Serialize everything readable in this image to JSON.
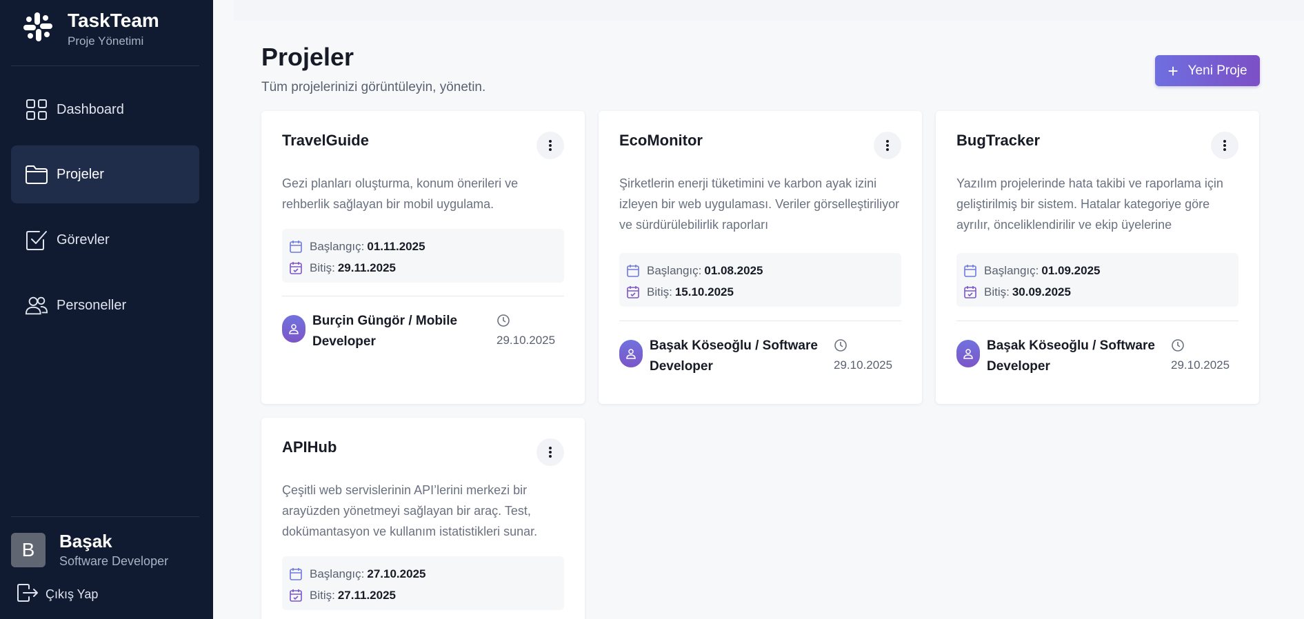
{
  "brand": {
    "name": "TaskTeam",
    "subtitle": "Proje Yönetimi"
  },
  "nav": [
    {
      "label": "Dashboard",
      "icon": "dashboard-grid-icon",
      "active": false
    },
    {
      "label": "Projeler",
      "icon": "folder-icon",
      "active": true
    },
    {
      "label": "Görevler",
      "icon": "checkbox-icon",
      "active": false
    },
    {
      "label": "Personeller",
      "icon": "users-icon",
      "active": false
    }
  ],
  "user": {
    "initial": "B",
    "name": "Başak",
    "role": "Software Developer",
    "logout_label": "Çıkış Yap"
  },
  "header": {
    "title": "Projeler",
    "subtitle": "Tüm projelerinizi görüntüleyin, yönetin.",
    "new_button_label": "Yeni Proje",
    "new_button_icon": "+"
  },
  "labels": {
    "start": "Başlangıç:",
    "end": "Bitiş:"
  },
  "colors": {
    "sidebar": "#101a30",
    "accent_start": "#6e6fe0",
    "accent_end": "#7d4fc6"
  },
  "projects": [
    {
      "title": "TravelGuide",
      "description": "Gezi planları oluşturma, konum önerileri ve rehberlik sağlayan bir mobil uygulama.",
      "start": "01.11.2025",
      "end": "29.11.2025",
      "owner": "Burçin Güngör / Mobile Developer",
      "created": "29.10.2025"
    },
    {
      "title": "EcoMonitor",
      "description": "Şirketlerin enerji tüketimini ve karbon ayak izini izleyen bir web uygulaması. Veriler görselleştiriliyor ve sürdürülebilirlik raporları",
      "start": "01.08.2025",
      "end": "15.10.2025",
      "owner": "Başak Köseoğlu / Software Developer",
      "created": "29.10.2025"
    },
    {
      "title": "BugTracker",
      "description": "Yazılım projelerinde hata takibi ve raporlama için geliştirilmiş bir sistem. Hatalar kategoriye göre ayrılır, önceliklendirilir ve ekip üyelerine",
      "start": "01.09.2025",
      "end": "30.09.2025",
      "owner": "Başak Köseoğlu / Software Developer",
      "created": "29.10.2025"
    },
    {
      "title": "APIHub",
      "description": "Çeşitli web servislerinin API’lerini merkezi bir arayüzden yönetmeyi sağlayan bir araç. Test, dokümantasyon ve kullanım istatistikleri sunar.",
      "start": "27.10.2025",
      "end": "27.11.2025"
    }
  ]
}
